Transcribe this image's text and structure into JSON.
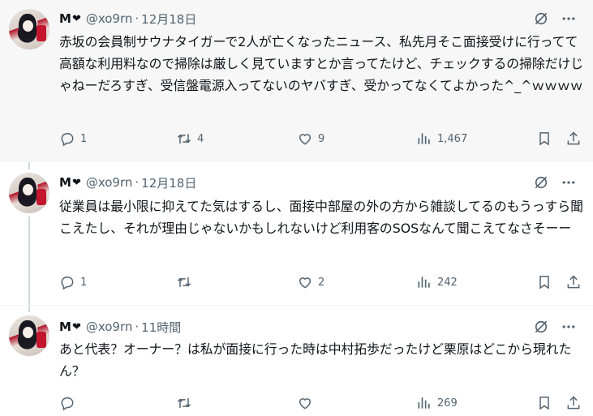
{
  "tweets": [
    {
      "name": "M",
      "heart": "❤",
      "handle": "@xo9rn",
      "separator": "·",
      "time": "12月18日",
      "text": "赤坂の会員制サウナタイガーで2人が亡くなったニュース、私先月そこ面接受けに行ってて高額な利用料なので掃除は厳しく見ていますとか言ってたけど、チェックするの掃除だけじゃねーだろすぎ、受信盤電源入ってないのヤバすぎ、受かってなくてよかった^_^ｗｗｗｗ",
      "replies": "1",
      "reposts": "4",
      "likes": "9",
      "views": "1,467"
    },
    {
      "name": "M",
      "heart": "❤",
      "handle": "@xo9rn",
      "separator": "·",
      "time": "12月18日",
      "text": "従業員は最小限に抑えてた気はするし、面接中部屋の外の方から雑談してるのもうっすら聞こえたし、それが理由じゃないかもしれないけど利用客のSOSなんて聞こえてなさそーー",
      "replies": "1",
      "reposts": "",
      "likes": "2",
      "views": "242"
    },
    {
      "name": "M",
      "heart": "❤",
      "handle": "@xo9rn",
      "separator": "·",
      "time": "11時間",
      "text": "あと代表？オーナー？は私が面接に行った時は中村拓歩だったけど栗原はどこから現れたん？",
      "replies": "",
      "reposts": "",
      "likes": "",
      "views": "269"
    }
  ],
  "icons": {
    "reply": "reply-icon",
    "repost": "repost-icon",
    "like": "like-icon",
    "views": "views-icon",
    "bookmark": "bookmark-icon",
    "share": "share-icon",
    "grok": "grok-icon",
    "more": "more-icon"
  },
  "colors": {
    "text": "#0f1419",
    "secondary": "#536471",
    "thread_line": "#cfd9de",
    "highlight_bg": "#f7f7f7"
  }
}
